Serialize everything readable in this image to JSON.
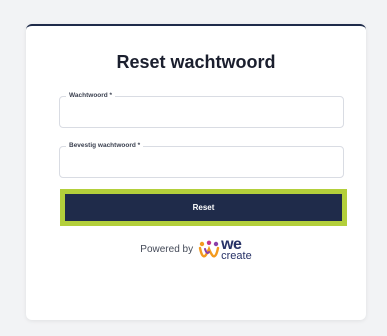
{
  "form": {
    "title": "Reset wachtwoord",
    "password_label": "Wachtwoord *",
    "password_value": "",
    "confirm_label": "Bevestig wachtwoord *",
    "confirm_value": "",
    "submit_label": "Reset"
  },
  "footer": {
    "powered_by": "Powered by",
    "brand_we": "we",
    "brand_create": "create",
    "logo_icon": "wecreate-people-logo-icon"
  },
  "colors": {
    "primary": "#1f2b4a",
    "highlight": "#b3cf3b",
    "brand": "#263166",
    "logo_orange": "#f39a1e",
    "logo_purple": "#8a3fa8",
    "logo_magenta": "#c2338a",
    "background": "#f2f3f5"
  }
}
